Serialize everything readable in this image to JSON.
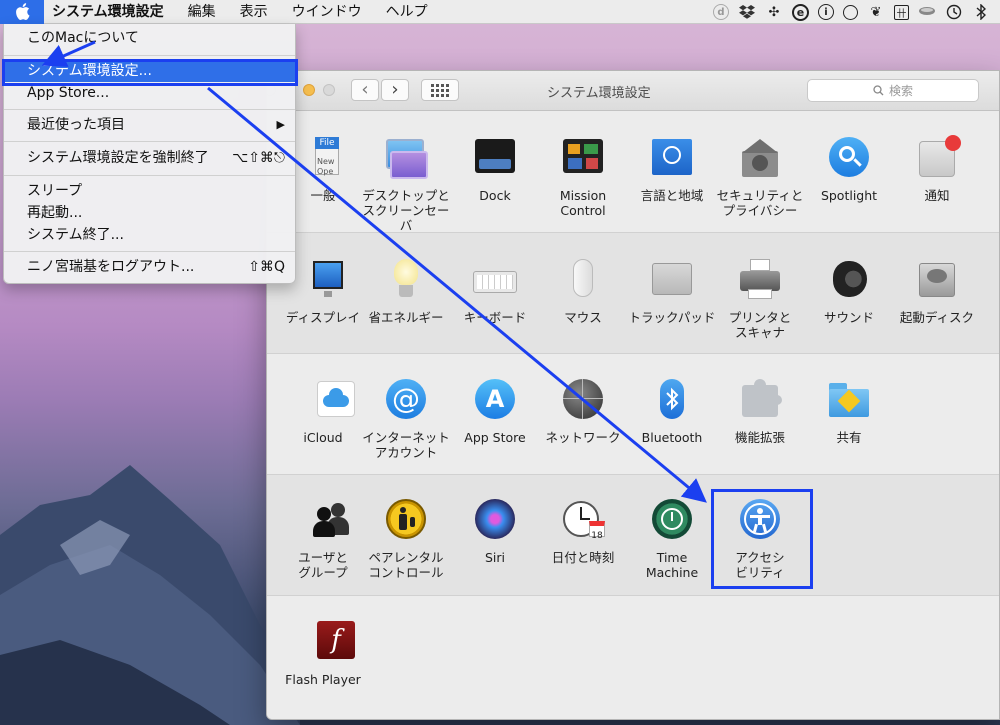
{
  "menubar": {
    "app_name": "システム環境設定",
    "menus": [
      "編集",
      "表示",
      "ウインドウ",
      "ヘルプ"
    ],
    "status_icons": [
      "d-icon",
      "dropbox-icon",
      "pinwheel-icon",
      "e-icon",
      "info-icon",
      "circle-icon",
      "evernote-icon",
      "grid-icon",
      "bowl-icon",
      "time-machine-icon",
      "bluetooth-icon"
    ]
  },
  "apple_menu": {
    "items": [
      {
        "label": "このMacについて",
        "shortcut": ""
      },
      {
        "label": "システム環境設定...",
        "shortcut": ""
      },
      {
        "label": "App Store...",
        "shortcut": ""
      },
      {
        "label": "最近使った項目",
        "shortcut": "▶"
      },
      {
        "label": "システム環境設定を強制終了",
        "shortcut": "⌥⇧⌘⎋"
      },
      {
        "label": "スリープ",
        "shortcut": ""
      },
      {
        "label": "再起動...",
        "shortcut": ""
      },
      {
        "label": "システム終了...",
        "shortcut": ""
      },
      {
        "label": "ニノ宮瑞基をログアウト...",
        "shortcut": "⇧⌘Q"
      }
    ]
  },
  "window": {
    "title": "システム環境設定",
    "search_placeholder": "検索",
    "back": "‹",
    "forward": "›",
    "grid": "⋮⋮⋮"
  },
  "prefs": {
    "row1": [
      {
        "label": "一般",
        "icon": "general-icon"
      },
      {
        "label": "デスクトップと\nスクリーンセーバ",
        "icon": "desktop-icon"
      },
      {
        "label": "Dock",
        "icon": "dock-icon"
      },
      {
        "label": "Mission\nControl",
        "icon": "mission-control-icon"
      },
      {
        "label": "言語と地域",
        "icon": "language-icon"
      },
      {
        "label": "セキュリティと\nプライバシー",
        "icon": "security-icon"
      },
      {
        "label": "Spotlight",
        "icon": "spotlight-icon"
      },
      {
        "label": "通知",
        "icon": "notifications-icon"
      }
    ],
    "row2": [
      {
        "label": "ディスプレイ",
        "icon": "display-icon"
      },
      {
        "label": "省エネルギー",
        "icon": "energy-icon"
      },
      {
        "label": "キーボード",
        "icon": "keyboard-icon"
      },
      {
        "label": "マウス",
        "icon": "mouse-icon"
      },
      {
        "label": "トラックパッド",
        "icon": "trackpad-icon"
      },
      {
        "label": "プリンタと\nスキャナ",
        "icon": "printer-icon"
      },
      {
        "label": "サウンド",
        "icon": "sound-icon"
      },
      {
        "label": "起動ディスク",
        "icon": "startup-disk-icon"
      }
    ],
    "row3": [
      {
        "label": "iCloud",
        "icon": "icloud-icon"
      },
      {
        "label": "インターネット\nアカウント",
        "icon": "internet-accounts-icon"
      },
      {
        "label": "App Store",
        "icon": "app-store-icon"
      },
      {
        "label": "ネットワーク",
        "icon": "network-icon"
      },
      {
        "label": "Bluetooth",
        "icon": "bluetooth-icon"
      },
      {
        "label": "機能拡張",
        "icon": "extensions-icon"
      },
      {
        "label": "共有",
        "icon": "sharing-icon"
      }
    ],
    "row4": [
      {
        "label": "ユーザと\nグループ",
        "icon": "users-icon"
      },
      {
        "label": "ペアレンタル\nコントロール",
        "icon": "parental-icon"
      },
      {
        "label": "Siri",
        "icon": "siri-icon"
      },
      {
        "label": "日付と時刻",
        "icon": "date-time-icon"
      },
      {
        "label": "Time\nMachine",
        "icon": "time-machine-icon"
      },
      {
        "label": "アクセシ\nビリティ",
        "icon": "accessibility-icon"
      }
    ],
    "row5": [
      {
        "label": "Flash Player",
        "icon": "flash-icon"
      }
    ]
  },
  "colors": {
    "accent": "#2f6fe8",
    "annotation": "#1b3ff0"
  }
}
